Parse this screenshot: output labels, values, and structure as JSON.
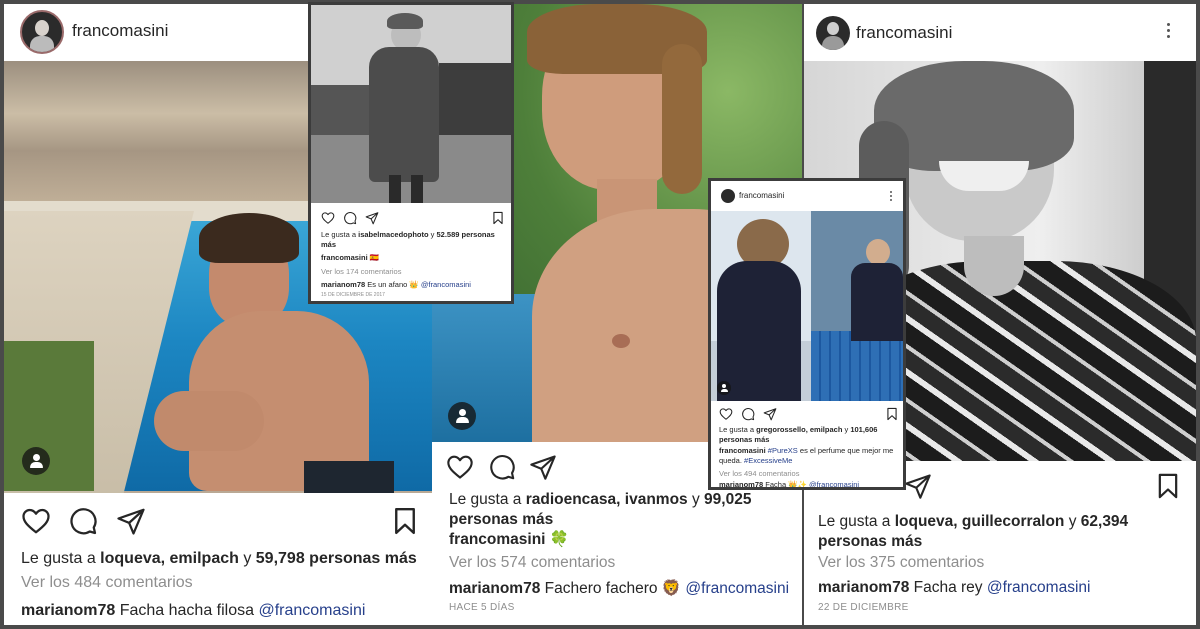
{
  "post1": {
    "username": "francomasini",
    "likes": {
      "prefix": "Le gusta a ",
      "names": "loqueva, emilpach",
      "mid": " y ",
      "count": "59,798 personas más"
    },
    "comments_link": "Ver los 484 comentarios",
    "comment": {
      "user": "marianom78",
      "text": " Facha hacha filosa ",
      "mention": "@francomasini"
    }
  },
  "post2": {
    "likes": {
      "prefix": "Le gusta a ",
      "names": "isabelmacedophoto",
      "mid": " y ",
      "count": "52.589 personas más"
    },
    "caption_user": "francomasini",
    "caption_emoji": "🇪🇸",
    "comments_link": "Ver los 174 comentarios",
    "comment": {
      "user": "marianom78",
      "text": " Es un afano 👑 ",
      "mention": "@francomasini"
    },
    "date": "15 DE DICIEMBRE DE 2017"
  },
  "post3": {
    "likes": {
      "prefix": "Le gusta a ",
      "names": "radioencasa, ivanmos",
      "mid": " y ",
      "count": "99,025 personas más"
    },
    "caption_user": "francomasini",
    "caption_emoji": "🍀",
    "comments_link": "Ver los 574 comentarios",
    "comment": {
      "user": "marianom78",
      "text": " Fachero fachero 🦁 ",
      "mention": "@francomasini"
    },
    "date": "HACE 5 DÍAS"
  },
  "post4": {
    "username": "francomasini",
    "likes": {
      "prefix": "Le gusta a ",
      "names": "gregorossello, emilpach",
      "mid": " y ",
      "count": "101,606 personas más"
    },
    "caption_user": "francomasini",
    "caption_pre": " ",
    "caption_tag": "#PureXS",
    "caption_mid": " es el perfume  que mejor me queda. ",
    "caption_tag2": "#ExcessiveMe",
    "comments_link": "Ver los 494 comentarios",
    "comment": {
      "user": "marianom78",
      "text": " Facha 👑✨ ",
      "mention": "@francomasini"
    }
  },
  "post5": {
    "username": "francomasini",
    "likes": {
      "prefix": "Le gusta a ",
      "names": "loqueva, guillecorralon",
      "mid": " y ",
      "count": "62,394 personas más"
    },
    "comments_link": "Ver los 375 comentarios",
    "comment": {
      "user": "marianom78",
      "text": " Facha rey ",
      "mention": "@francomasini"
    },
    "date": "22 DE DICIEMBRE"
  },
  "icons": [
    "heart-icon",
    "comment-icon",
    "share-icon",
    "bookmark-icon",
    "more-options-icon",
    "tagged-user-icon"
  ],
  "colors": {
    "link": "#27408b",
    "muted": "#8e8e8e",
    "text": "#262626"
  }
}
